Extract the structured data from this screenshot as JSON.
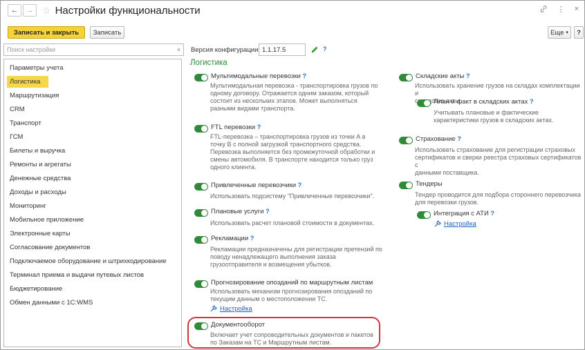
{
  "window": {
    "title": "Настройки функциональности",
    "back_icon": "arrow-left-icon",
    "forward_icon": "arrow-right-icon",
    "star_icon": "star-icon",
    "link_icon": "link-icon",
    "more_icon": "more-vertical-icon",
    "close_icon": "close-icon",
    "close_glyph": "×",
    "more_glyph": "⋮"
  },
  "toolbar": {
    "save_close": "Записать и закрыть",
    "save": "Записать",
    "more": "Еще",
    "help": "?"
  },
  "search": {
    "placeholder": "Поиск настройки",
    "clear": "×"
  },
  "version": {
    "label": "Версия конфигурации:",
    "value": "1.1.17.5",
    "help": "?"
  },
  "sidebar": {
    "items": [
      "Параметры учета",
      "Логистика",
      "Маршрутизация",
      "CRM",
      "Транспорт",
      "ГСМ",
      "Билеты и выручка",
      "Ремонты и агрегаты",
      "Денежные средства",
      "Доходы и расходы",
      "Мониторинг",
      "Мобильное приложение",
      "Электронные карты",
      "Согласование документов",
      "Подключаемое оборудование и штрихкодирование",
      "Терминал приема и выдачи путевых листов",
      "Бюджетирование",
      "Обмен данными с 1С:WMS"
    ],
    "selected": "Логистика"
  },
  "main": {
    "section_title": "Логистика",
    "help": "?",
    "settings_link": "Настройка",
    "options": {
      "multimodal": {
        "label": "Мультимодальные перевозки",
        "desc": [
          "Мультимодальная перевозка - транспортировка грузов по",
          "одному договору. Отражается одним заказом, который",
          "состоит из нескольких этапов. Может выполняться",
          "разными видами транспорта."
        ]
      },
      "ftl": {
        "label": "FTL перевозки",
        "desc": [
          "FTL-перевозка – транспортировка грузов из точки А в",
          "точку В с полной загрузкой транспортного средства.",
          "Перевозка выполняется без промежуточной обработки и",
          "смены автомобиля. В транспорте находится только груз",
          "одного клиента."
        ]
      },
      "carriers": {
        "label": "Привлеченные перевозчики",
        "desc": [
          "Использовать подсистему \"Привлеченные перевозчики\"."
        ]
      },
      "planned": {
        "label": "Плановые услуги",
        "desc": [
          "Использовать расчет плановой стоимости в документах."
        ]
      },
      "claims": {
        "label": "Рекламации",
        "desc": [
          "Рекламации предназначены для регистрации претензий по",
          "поводу ненадлежащего выполнения заказа",
          "грузоотправителя и возмещения убытков."
        ]
      },
      "forecast": {
        "label": "Прогнозирование опозданий по маршрутным листам",
        "desc": [
          "Использовать механизм прогнозирования опозданий по",
          "текущим данным о местоположении ТС."
        ]
      },
      "docflow": {
        "label": "Документооборот",
        "desc": [
          "Включает учет сопроводительных документов и пакетов",
          "по Заказам на ТС и Маршрутным листам."
        ]
      },
      "warehouse": {
        "label": "Складские акты",
        "desc": [
          "Использовать хранение грузов на складах комплектации и",
          "складские акты."
        ]
      },
      "planfact": {
        "label": "План и факт в складских актах",
        "desc": [
          "Учитывать плановые и фактические",
          "характеристики грузов в складских актах."
        ]
      },
      "insurance": {
        "label": "Страхование",
        "desc": [
          "Использовать страхование для регистрации страховых",
          "сертификатов и сверки реестра страховых сертификатов с",
          "данными поставщика."
        ]
      },
      "tenders": {
        "label": "Тендеры",
        "desc": [
          "Тендер проводится для подбора стороннего перевозчика",
          "для перевозки грузов."
        ]
      },
      "ati": {
        "label": "Интеграция с АТИ"
      }
    }
  },
  "colors": {
    "accent_yellow": "#f5d23a",
    "toggle_green": "#2f8a3a",
    "section_green": "#2e8a3a",
    "link_blue": "#1f5fbf",
    "highlight_red": "#d0343a"
  }
}
